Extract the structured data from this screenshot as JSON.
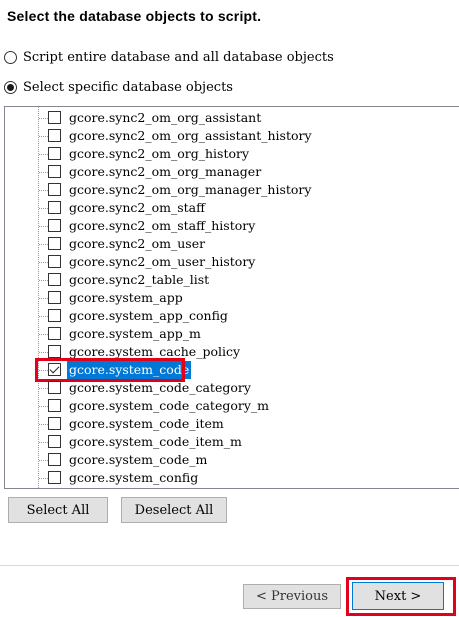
{
  "heading": "Select the database objects to script.",
  "options": {
    "entire": "Script entire database and all database objects",
    "specific": "Select specific database objects",
    "selected": "specific"
  },
  "tree": {
    "items": [
      {
        "label": "gcore.sync2_om_org_assistant",
        "checked": false,
        "selected": false
      },
      {
        "label": "gcore.sync2_om_org_assistant_history",
        "checked": false,
        "selected": false
      },
      {
        "label": "gcore.sync2_om_org_history",
        "checked": false,
        "selected": false
      },
      {
        "label": "gcore.sync2_om_org_manager",
        "checked": false,
        "selected": false
      },
      {
        "label": "gcore.sync2_om_org_manager_history",
        "checked": false,
        "selected": false
      },
      {
        "label": "gcore.sync2_om_staff",
        "checked": false,
        "selected": false
      },
      {
        "label": "gcore.sync2_om_staff_history",
        "checked": false,
        "selected": false
      },
      {
        "label": "gcore.sync2_om_user",
        "checked": false,
        "selected": false
      },
      {
        "label": "gcore.sync2_om_user_history",
        "checked": false,
        "selected": false
      },
      {
        "label": "gcore.sync2_table_list",
        "checked": false,
        "selected": false
      },
      {
        "label": "gcore.system_app",
        "checked": false,
        "selected": false
      },
      {
        "label": "gcore.system_app_config",
        "checked": false,
        "selected": false
      },
      {
        "label": "gcore.system_app_m",
        "checked": false,
        "selected": false
      },
      {
        "label": "gcore.system_cache_policy",
        "checked": false,
        "selected": false
      },
      {
        "label": "gcore.system_code",
        "checked": true,
        "selected": true
      },
      {
        "label": "gcore.system_code_category",
        "checked": false,
        "selected": false
      },
      {
        "label": "gcore.system_code_category_m",
        "checked": false,
        "selected": false
      },
      {
        "label": "gcore.system_code_item",
        "checked": false,
        "selected": false
      },
      {
        "label": "gcore.system_code_item_m",
        "checked": false,
        "selected": false
      },
      {
        "label": "gcore.system_code_m",
        "checked": false,
        "selected": false
      },
      {
        "label": "gcore.system_config",
        "checked": false,
        "selected": false
      }
    ]
  },
  "buttons": {
    "select_all": "Select All",
    "deselect_all": "Deselect All",
    "previous": "< Previous",
    "next": "Next >"
  },
  "colors": {
    "selection": "#0078d7",
    "highlight_box": "#e3001b"
  }
}
